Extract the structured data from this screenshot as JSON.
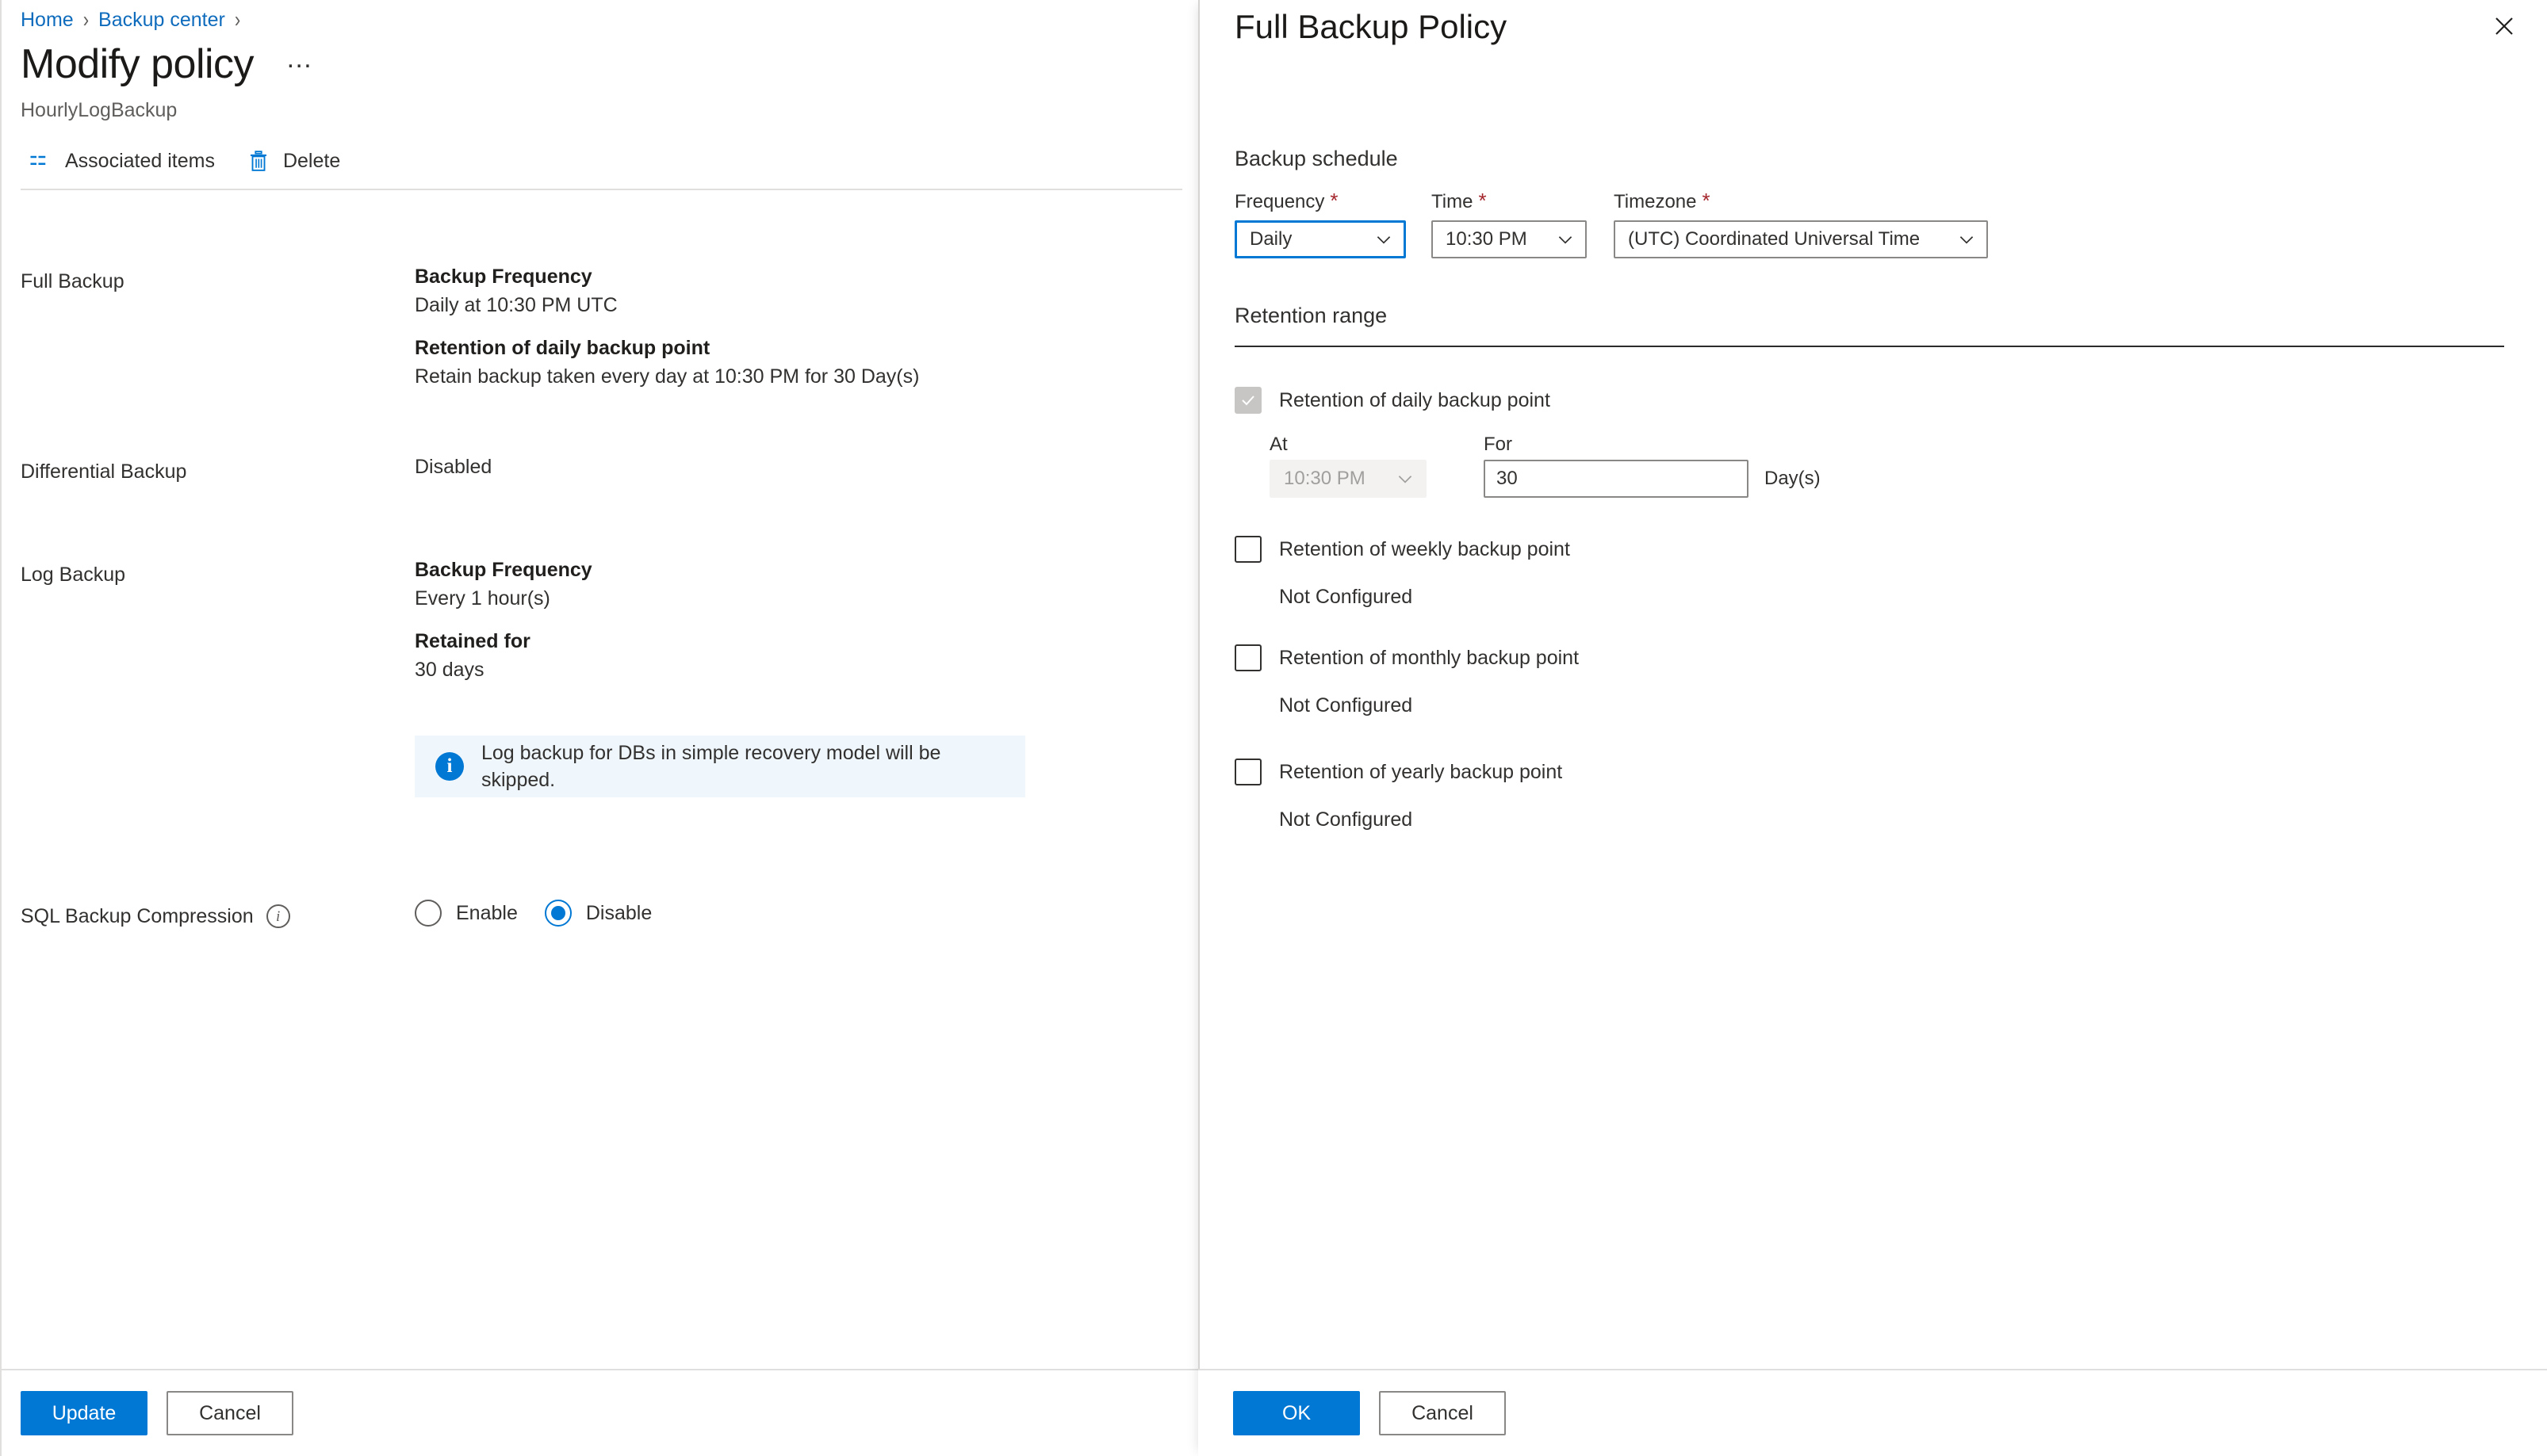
{
  "left_blade": {
    "breadcrumb": {
      "items": [
        {
          "label": "Home"
        },
        {
          "label": "Backup center"
        }
      ],
      "separator": "›"
    },
    "title": "Modify policy",
    "more_actions_label": "…",
    "subtitle": "HourlyLogBackup",
    "command_bar": {
      "associated_items_label": "Associated items",
      "associated_items_icon": "list-icon",
      "delete_label": "Delete",
      "delete_icon": "trash-icon"
    },
    "rows": {
      "full_backup": {
        "label": "Full Backup",
        "frequency_heading": "Backup Frequency",
        "frequency_value": "Daily at 10:30 PM UTC",
        "retention_heading": "Retention of daily backup point",
        "retention_value": "Retain backup taken every day at 10:30 PM for 30 Day(s)"
      },
      "differential_backup": {
        "label": "Differential Backup",
        "value": "Disabled"
      },
      "log_backup": {
        "label": "Log Backup",
        "frequency_heading": "Backup Frequency",
        "frequency_value": "Every 1 hour(s)",
        "retained_heading": "Retained for",
        "retained_value": "30 days"
      },
      "info_banner": {
        "icon": "info-icon",
        "text": "Log backup for DBs in simple recovery model will be skipped."
      },
      "sql_backup_compression": {
        "label": "SQL Backup Compression",
        "info_icon": "info-circle-icon",
        "options": [
          {
            "label": "Enable",
            "selected": false
          },
          {
            "label": "Disable",
            "selected": true
          }
        ]
      }
    },
    "footer": {
      "update_label": "Update",
      "cancel_label": "Cancel"
    }
  },
  "right_blade": {
    "title": "Full Backup Policy",
    "close_icon": "close-icon",
    "backup_schedule": {
      "heading": "Backup schedule",
      "fields": [
        {
          "label": "Frequency",
          "required": true,
          "value": "Daily",
          "focused": true,
          "disabled": false
        },
        {
          "label": "Time",
          "required": true,
          "value": "10:30 PM",
          "focused": false,
          "disabled": false
        },
        {
          "label": "Timezone",
          "required": true,
          "value": "(UTC) Coordinated Universal Time",
          "focused": false,
          "disabled": false
        }
      ]
    },
    "retention_range": {
      "heading": "Retention range",
      "daily": {
        "label": "Retention of daily backup point",
        "checked": true,
        "disabled": true,
        "at_label": "At",
        "at_value": "10:30 PM",
        "at_disabled": true,
        "for_label": "For",
        "for_value": "30",
        "unit_label": "Day(s)"
      },
      "weekly": {
        "label": "Retention of weekly backup point",
        "checked": false,
        "status": "Not Configured"
      },
      "monthly": {
        "label": "Retention of monthly backup point",
        "checked": false,
        "status": "Not Configured"
      },
      "yearly": {
        "label": "Retention of yearly backup point",
        "checked": false,
        "status": "Not Configured"
      }
    },
    "footer": {
      "ok_label": "OK",
      "cancel_label": "Cancel"
    }
  },
  "colors": {
    "accent": "#0078d4",
    "link": "#0f6cbd",
    "required_star": "#a4262c",
    "info_banner_bg": "#eff6fc",
    "disabled_bg": "#f3f2f1",
    "disabled_checkbox": "#c8c6c4"
  }
}
